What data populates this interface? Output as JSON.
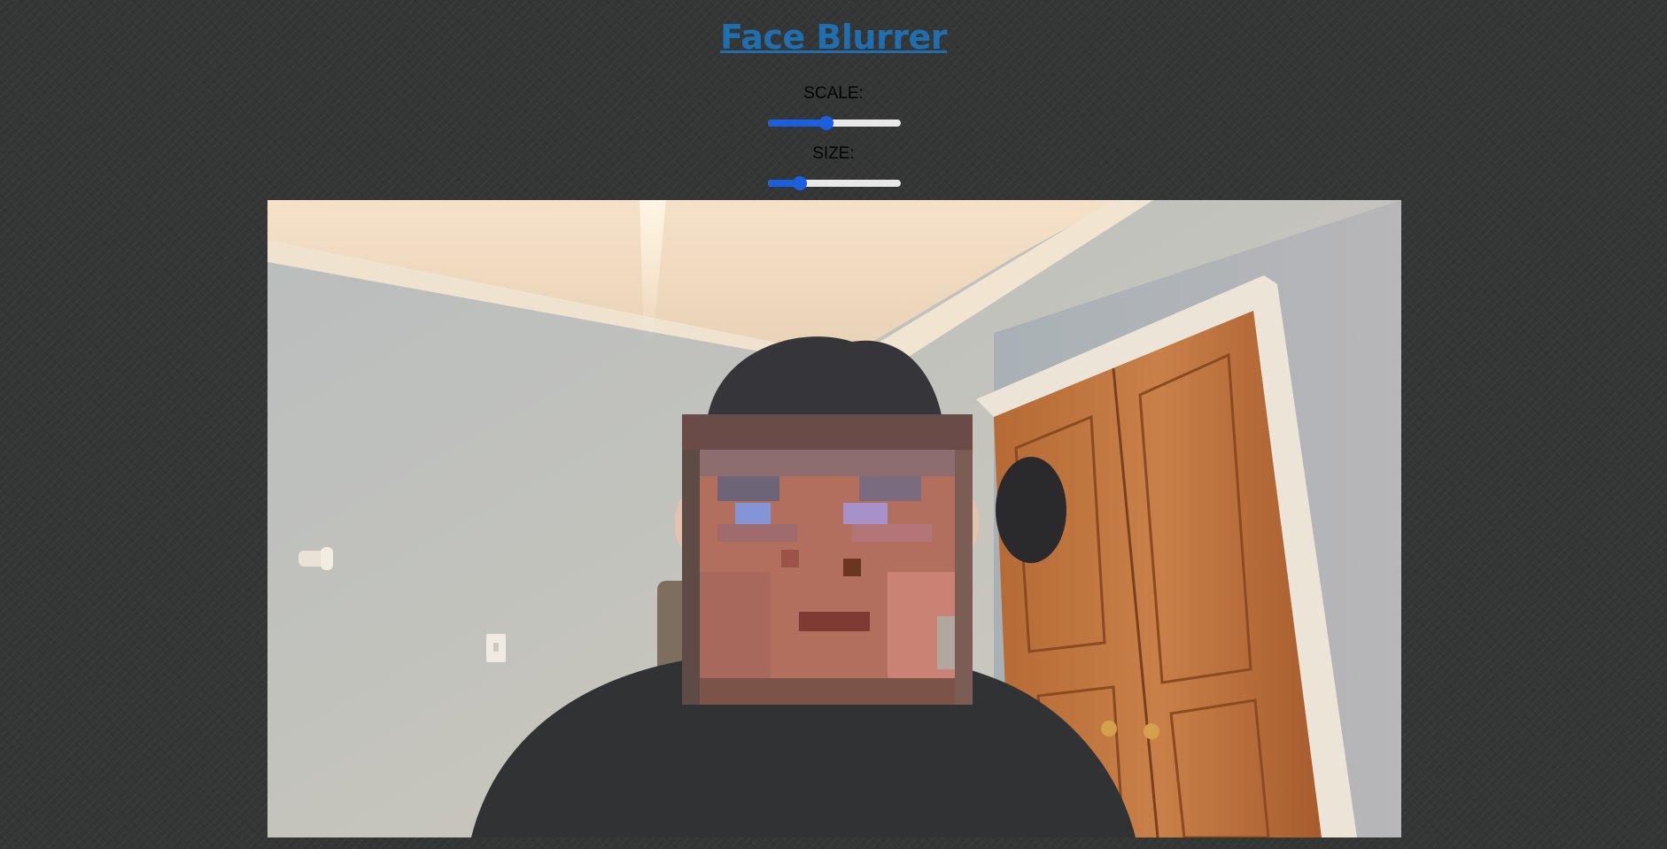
{
  "app": {
    "title": "Face Blurrer"
  },
  "controls": {
    "scale": {
      "label": "SCALE:",
      "value": 0.44
    },
    "size": {
      "label": "SIZE:",
      "value": 0.24
    }
  },
  "colors": {
    "background": "#343636",
    "title": "#1f6fb0",
    "slider_accent": "#1a5fe0",
    "slider_track": "#e8e8e8"
  },
  "video": {
    "description_icon": "webcam-feed"
  }
}
